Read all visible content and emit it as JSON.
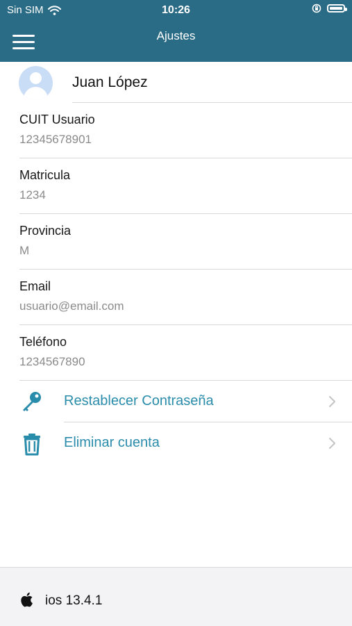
{
  "status_bar": {
    "carrier": "Sin SIM",
    "time": "10:26"
  },
  "header": {
    "title": "Ajustes"
  },
  "profile": {
    "name": "Juan López"
  },
  "fields": [
    {
      "label": "CUIT Usuario",
      "value": "12345678901"
    },
    {
      "label": "Matricula",
      "value": "1234"
    },
    {
      "label": "Provincia",
      "value": "M"
    },
    {
      "label": "Email",
      "value": "usuario@email.com"
    },
    {
      "label": "Teléfono",
      "value": "1234567890"
    }
  ],
  "actions": [
    {
      "label": "Restablecer Contraseña",
      "icon": "key-icon"
    },
    {
      "label": "Eliminar cuenta",
      "icon": "trash-icon"
    }
  ],
  "footer": {
    "icon": "apple-icon",
    "version": "ios 13.4.1"
  },
  "colors": {
    "header": "#2a6b85",
    "accent": "#2a8cab",
    "muted_text": "#8a8a8a",
    "footer": "#f3f3f5"
  }
}
